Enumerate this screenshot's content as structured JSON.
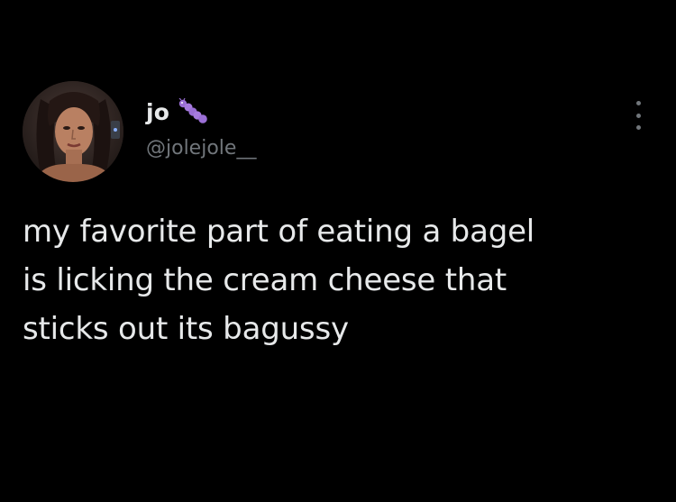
{
  "tweet": {
    "author": {
      "display_name": "jo",
      "handle": "@jolejole__",
      "name_emoji": "caterpillar-emoji",
      "avatar_icon": "profile-photo"
    },
    "more_icon": "more-options-icon",
    "text_lines": [
      "my favorite part of eating a bagel",
      "is licking the cream cheese that",
      "sticks out its bagussy"
    ]
  },
  "colors": {
    "background": "#000000",
    "text": "#e7e9ea",
    "secondary_text": "#71767b",
    "emoji_purple": "#9b6fd6"
  }
}
